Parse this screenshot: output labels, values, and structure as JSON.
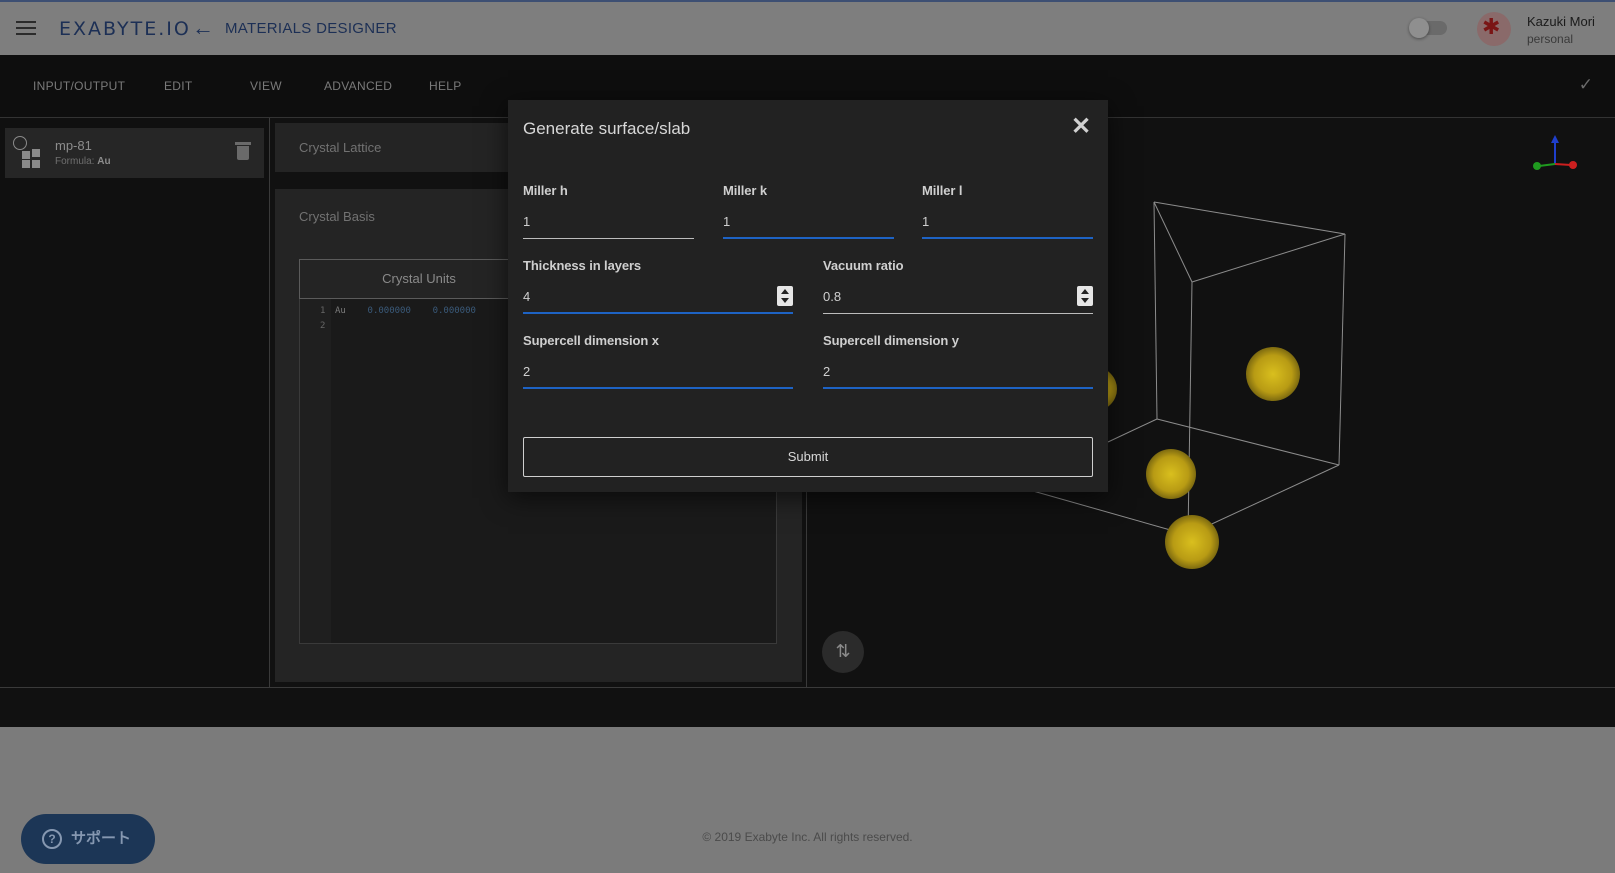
{
  "header": {
    "logo": "EXABYTE.IO",
    "title": "MATERIALS DESIGNER",
    "user_name": "Kazuki Mori",
    "user_plan": "personal"
  },
  "menu": {
    "items": [
      "INPUT/OUTPUT",
      "EDIT",
      "VIEW",
      "ADVANCED",
      "HELP"
    ]
  },
  "materials": [
    {
      "name": "mp-81",
      "formula_label": "Formula:",
      "formula": "Au"
    }
  ],
  "editor": {
    "lattice_title": "Crystal Lattice",
    "basis_title": "Crystal Basis",
    "units_tab": "Crystal Units",
    "line_numbers": [
      "1",
      "2"
    ],
    "line1_element": "Au",
    "line1_x": "0.000000",
    "line1_y": "0.000000"
  },
  "modal": {
    "title": "Generate surface/slab",
    "fields": {
      "miller_h": {
        "label": "Miller h",
        "value": "1"
      },
      "miller_k": {
        "label": "Miller k",
        "value": "1"
      },
      "miller_l": {
        "label": "Miller l",
        "value": "1"
      },
      "thickness": {
        "label": "Thickness in layers",
        "value": "4"
      },
      "vacuum": {
        "label": "Vacuum ratio",
        "value": "0.8"
      },
      "supercell_x": {
        "label": "Supercell dimension x",
        "value": "2"
      },
      "supercell_y": {
        "label": "Supercell dimension y",
        "value": "2"
      }
    },
    "submit_label": "Submit"
  },
  "footer": {
    "copyright": "© 2019 Exabyte Inc. All rights reserved.",
    "support_label": "サポート"
  },
  "colors": {
    "accent": "#1e63c4",
    "atom": "#d4b81c",
    "axis_x": "#cc1f1f",
    "axis_y": "#1f9a1f",
    "axis_z": "#1f3fcc"
  },
  "icons": [
    "menu-icon",
    "back-arrow-icon",
    "check-icon",
    "trash-icon",
    "close-icon",
    "swap-icon",
    "help-icon"
  ]
}
